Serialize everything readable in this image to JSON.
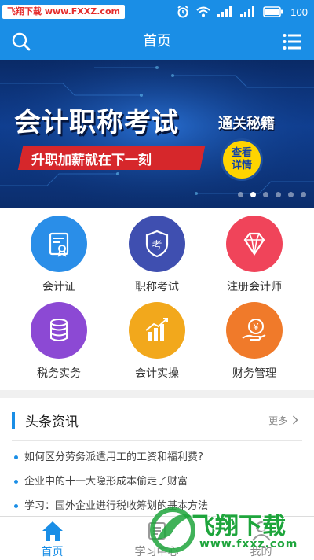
{
  "status_bar": {
    "watermark_text": "飞翔下载 www.FXXZ.com",
    "battery": "100"
  },
  "header": {
    "title": "首页"
  },
  "banner": {
    "title": "会计职称考试",
    "subtitle": "通关秘籍",
    "slogan": "升职加薪就在下一刻",
    "badge_line1": "查看",
    "badge_line2": "详情",
    "slide_count": 6,
    "active_slide": 2
  },
  "grid": [
    {
      "label": "会计证",
      "icon": "certificate-icon",
      "color": "#2a8ee8"
    },
    {
      "label": "职称考试",
      "icon": "exam-shield-icon",
      "color": "#3f4fb0"
    },
    {
      "label": "注册会计师",
      "icon": "diamond-icon",
      "color": "#f0445a"
    },
    {
      "label": "税务实务",
      "icon": "coins-icon",
      "color": "#8c49d4"
    },
    {
      "label": "会计实操",
      "icon": "bar-chart-icon",
      "color": "#f2a81c"
    },
    {
      "label": "财务管理",
      "icon": "money-hand-icon",
      "color": "#f07a2a"
    }
  ],
  "news": {
    "title": "头条资讯",
    "more": "更多",
    "items": [
      "如何区分劳务派遣用工的工资和福利费?",
      "企业中的十一大隐形成本偷走了财富",
      "学习：国外企业进行税收筹划的基本方法"
    ]
  },
  "bottom_nav": [
    {
      "label": "首页",
      "icon": "home-icon",
      "active": true
    },
    {
      "label": "学习中心",
      "icon": "study-icon",
      "active": false
    },
    {
      "label": "我的",
      "icon": "user-icon",
      "active": false
    }
  ],
  "watermark": {
    "brand": "飞翔下载",
    "url": "www.fxxz.com"
  },
  "colors": {
    "primary": "#1a8ee6",
    "ribbon": "#d6272b",
    "badge": "#ffd400"
  }
}
